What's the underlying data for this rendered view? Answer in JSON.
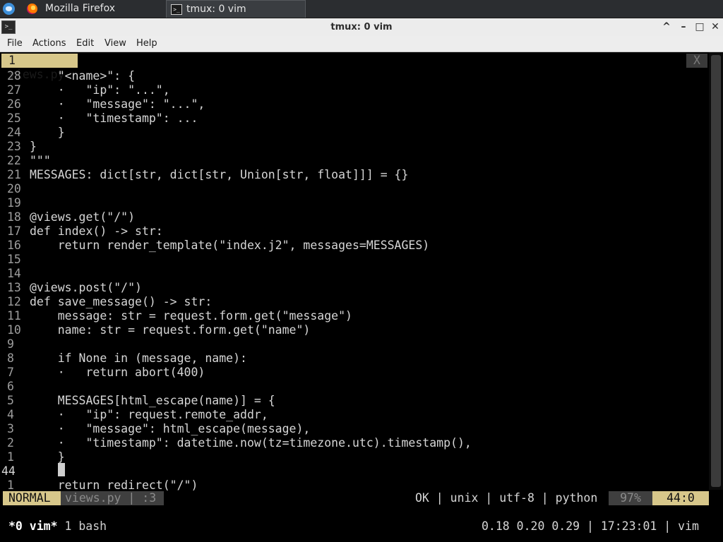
{
  "taskbar": {
    "tasks": [
      {
        "label": "Mozilla Firefox"
      },
      {
        "label": "tmux: 0 vim"
      }
    ]
  },
  "window": {
    "title": "tmux: 0 vim",
    "controls": {
      "minimize": "^",
      "restore": "–",
      "maximize": "□",
      "close": "✕"
    }
  },
  "menubar": {
    "items": [
      "File",
      "Actions",
      "Edit",
      "View",
      "Help"
    ]
  },
  "vim": {
    "tab_label": "1 views.py",
    "tab_close": "X",
    "lines": [
      {
        "num": "28",
        "text": "    \"<name>\": {"
      },
      {
        "num": "27",
        "text": "    ·   \"ip\": \"...\","
      },
      {
        "num": "26",
        "text": "    ·   \"message\": \"...\","
      },
      {
        "num": "25",
        "text": "    ·   \"timestamp\": ..."
      },
      {
        "num": "24",
        "text": "    }"
      },
      {
        "num": "23",
        "text": "}"
      },
      {
        "num": "22",
        "text": "\"\"\""
      },
      {
        "num": "21",
        "text": "MESSAGES: dict[str, dict[str, Union[str, float]]] = {}"
      },
      {
        "num": "20",
        "text": ""
      },
      {
        "num": "19",
        "text": ""
      },
      {
        "num": "18",
        "text": "@views.get(\"/\")"
      },
      {
        "num": "17",
        "text": "def index() -> str:"
      },
      {
        "num": "16",
        "text": "    return render_template(\"index.j2\", messages=MESSAGES)"
      },
      {
        "num": "15",
        "text": ""
      },
      {
        "num": "14",
        "text": ""
      },
      {
        "num": "13",
        "text": "@views.post(\"/\")"
      },
      {
        "num": "12",
        "text": "def save_message() -> str:"
      },
      {
        "num": "11",
        "text": "    message: str = request.form.get(\"message\")"
      },
      {
        "num": "10",
        "text": "    name: str = request.form.get(\"name\")"
      },
      {
        "num": "9",
        "text": ""
      },
      {
        "num": "8",
        "text": "    if None in (message, name):"
      },
      {
        "num": "7",
        "text": "    ·   return abort(400)"
      },
      {
        "num": "6",
        "text": ""
      },
      {
        "num": "5",
        "text": "    MESSAGES[html_escape(name)] = {"
      },
      {
        "num": "4",
        "text": "    ·   \"ip\": request.remote_addr,"
      },
      {
        "num": "3",
        "text": "    ·   \"message\": html_escape(message),"
      },
      {
        "num": "2",
        "text": "    ·   \"timestamp\": datetime.now(tz=timezone.utc).timestamp(),"
      },
      {
        "num": "1",
        "text": "    }"
      },
      {
        "num": "44",
        "text": ""
      },
      {
        "num": "1",
        "text": "    return redirect(\"/\")"
      }
    ],
    "status": {
      "mode": "NORMAL",
      "file": "views.py  | :3",
      "right": "OK | unix | utf-8 | python",
      "percent": "97%",
      "position": "44:0"
    }
  },
  "tmux": {
    "active_window": "*0 vim*",
    "other_window": "1 bash",
    "right": "0.18 0.20 0.29 | 17:23:01 | vim"
  },
  "colors": {
    "accent": "#d7c78a",
    "bracket": "#b866b8"
  }
}
